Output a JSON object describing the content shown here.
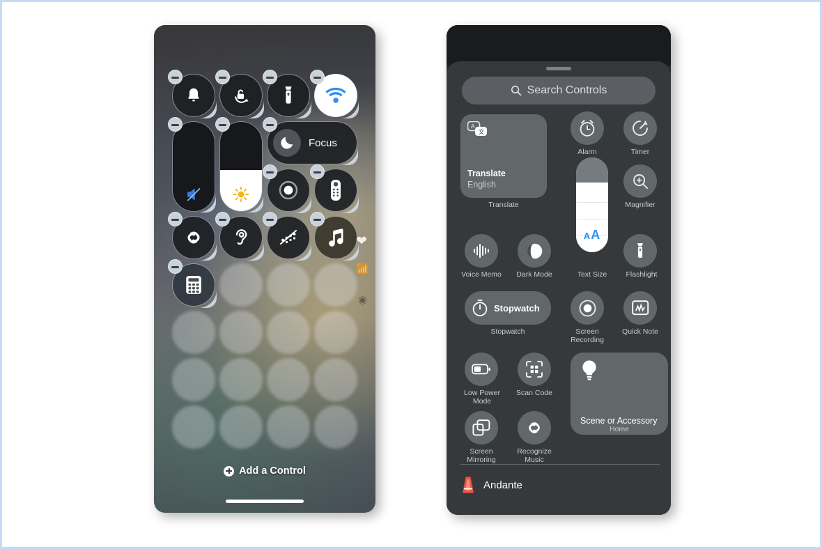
{
  "page": {
    "background": "#ffffff",
    "border_color": "#c3dcf5"
  },
  "left_phone": {
    "name": "control-center-edit-mode",
    "add_control_label": "Add a Control",
    "controls": [
      {
        "id": "ringer",
        "label": "Ringer",
        "icon": "bell-icon",
        "shape": "round",
        "state": "off"
      },
      {
        "id": "rotation-lock",
        "label": "Rotation Lock",
        "icon": "rotation-lock-icon",
        "shape": "round",
        "state": "off"
      },
      {
        "id": "flashlight",
        "label": "Flashlight",
        "icon": "flashlight-icon",
        "shape": "round",
        "state": "off"
      },
      {
        "id": "wifi",
        "label": "Wi-Fi",
        "icon": "wifi-icon",
        "shape": "round",
        "state": "on"
      },
      {
        "id": "volume",
        "label": "Volume",
        "icon": "volume-mute-icon",
        "shape": "vslider",
        "fill_percent": 0
      },
      {
        "id": "brightness",
        "label": "Brightness",
        "icon": "brightness-sun-icon",
        "shape": "vslider",
        "fill_percent": 46
      },
      {
        "id": "focus",
        "label": "Focus",
        "icon": "moon-icon",
        "shape": "pill",
        "state": "off"
      },
      {
        "id": "screen-record",
        "label": "Screen Recording",
        "icon": "record-circle-icon",
        "shape": "round",
        "state": "off"
      },
      {
        "id": "apple-tv-remote",
        "label": "Apple TV Remote",
        "icon": "remote-icon",
        "shape": "round",
        "state": "off"
      },
      {
        "id": "shazam",
        "label": "Recognize Music",
        "icon": "shazam-icon",
        "shape": "round",
        "state": "off"
      },
      {
        "id": "hearing",
        "label": "Hearing",
        "icon": "ear-icon",
        "shape": "round",
        "state": "off"
      },
      {
        "id": "sound-recog",
        "label": "Sound Recognition",
        "icon": "sound-recognition-icon",
        "shape": "round",
        "state": "off"
      },
      {
        "id": "music",
        "label": "Music",
        "icon": "music-note-icon",
        "shape": "round",
        "state": "off"
      },
      {
        "id": "calculator",
        "label": "Calculator",
        "icon": "calculator-icon",
        "shape": "round",
        "state": "off"
      }
    ],
    "badges": {
      "remove": "minus-badge",
      "resize": "resize-handle"
    },
    "wallpaper_glyphs": [
      "heart-icon",
      "signal-waves-icon",
      "ring-icon"
    ]
  },
  "right_phone": {
    "name": "add-a-control-gallery",
    "search": {
      "placeholder": "Search Controls",
      "icon": "search-icon"
    },
    "now_playing": {
      "title": "Andante",
      "icon": "metronome-icon"
    },
    "gallery": [
      {
        "id": "translate",
        "tile_title": "Translate",
        "tile_subtitle": "English",
        "label": "Translate",
        "icon": "translate-icon",
        "shape": "rect"
      },
      {
        "id": "alarm",
        "label": "Alarm",
        "icon": "alarm-clock-icon",
        "shape": "round"
      },
      {
        "id": "timer",
        "label": "Timer",
        "icon": "timer-icon",
        "shape": "round"
      },
      {
        "id": "text-size",
        "label": "Text Size",
        "icon": "text-size-aa-icon",
        "shape": "slider",
        "value": "AA"
      },
      {
        "id": "magnifier",
        "label": "Magnifier",
        "icon": "magnifier-icon",
        "shape": "round"
      },
      {
        "id": "voice-memo",
        "label": "Voice Memo",
        "icon": "waveform-icon",
        "shape": "round"
      },
      {
        "id": "dark-mode",
        "label": "Dark Mode",
        "icon": "dark-mode-icon",
        "shape": "round"
      },
      {
        "id": "flashlight",
        "label": "Flashlight",
        "icon": "flashlight-icon",
        "shape": "round"
      },
      {
        "id": "stopwatch",
        "tile_title": "Stopwatch",
        "label": "Stopwatch",
        "icon": "stopwatch-icon",
        "shape": "pill"
      },
      {
        "id": "screen-recording",
        "label": "Screen Recording",
        "icon": "record-circle-icon",
        "shape": "round"
      },
      {
        "id": "quick-note",
        "label": "Quick Note",
        "icon": "quick-note-icon",
        "shape": "round"
      },
      {
        "id": "low-power-mode",
        "label": "Low Power Mode",
        "icon": "battery-icon",
        "shape": "round"
      },
      {
        "id": "scan-code",
        "label": "Scan Code",
        "icon": "scan-code-icon",
        "shape": "round"
      },
      {
        "id": "scene-or-accessory",
        "tile_title": "Scene or Accessory",
        "label": "Home",
        "icon": "lightbulb-icon",
        "shape": "rect"
      },
      {
        "id": "screen-mirroring",
        "label": "Screen Mirroring",
        "icon": "screen-mirroring-icon",
        "shape": "round"
      },
      {
        "id": "recognize-music",
        "label": "Recognize Music",
        "icon": "shazam-icon",
        "shape": "round"
      }
    ]
  },
  "colors": {
    "sheet": "#36393b",
    "tile": "rgba(140,146,150,0.52)",
    "label": "#c6cbcf",
    "accent_blue": "#2f8ef0",
    "accent_red": "#f2503c"
  }
}
